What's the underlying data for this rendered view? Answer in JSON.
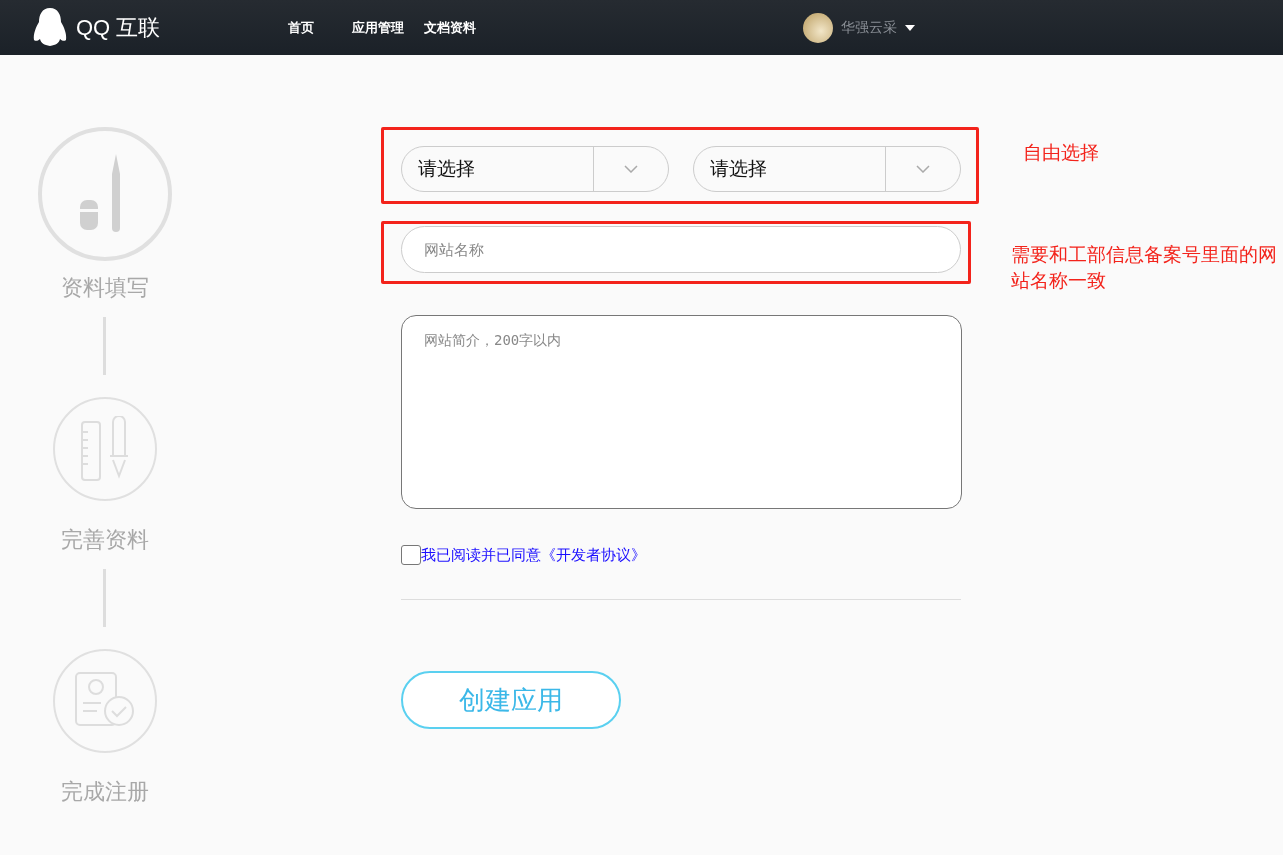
{
  "header": {
    "logo_text": "QQ 互联",
    "nav": [
      {
        "label": "首页"
      },
      {
        "label": "应用管理"
      },
      {
        "label": "文档资料"
      }
    ],
    "user": {
      "name": "华强云采"
    }
  },
  "steps": [
    {
      "label": "资料填写",
      "kind": "fill",
      "selected": true
    },
    {
      "label": "完善资料",
      "kind": "tools",
      "selected": false
    },
    {
      "label": "完成注册",
      "kind": "done",
      "selected": false
    }
  ],
  "form": {
    "selects": [
      {
        "value": "请选择"
      },
      {
        "value": "请选择"
      }
    ],
    "select_note": "自由选择",
    "name_field": {
      "placeholder": "网站名称"
    },
    "name_note": "需要和工部信息备案号里面的网站名称一致",
    "description": {
      "placeholder": "网站简介，200字以内"
    },
    "agreement": {
      "label": "我已阅读并已同意《开发者协议》",
      "checked": false
    },
    "submit": "创建应用"
  }
}
